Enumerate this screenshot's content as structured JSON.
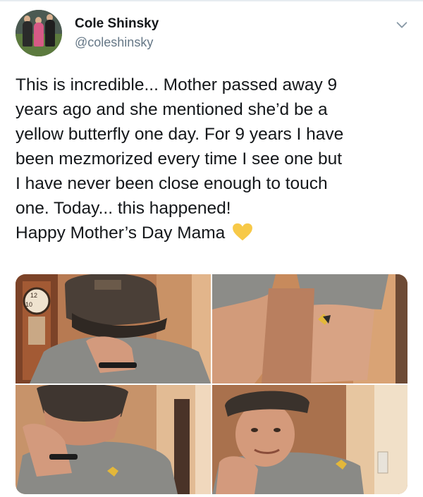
{
  "tweet": {
    "author_name": "Cole Shinsky",
    "author_handle": "@coleshinsky",
    "text_lines": [
      "This is incredible... Mother passed away 9",
      "years ago and she mentioned she’d be a",
      "yellow butterfly one day. For 9 years I have",
      "been mezmorized every time I see one but",
      "I have never been close enough to touch",
      "one. Today... this happened!",
      "Happy Mother’s Day Mama"
    ],
    "emoji_icon": "yellow-heart-icon"
  },
  "media": {
    "photos": [
      {
        "name": "photo-man-head-down-hat"
      },
      {
        "name": "photo-butterfly-on-arm"
      },
      {
        "name": "photo-man-hand-on-face"
      },
      {
        "name": "photo-man-smiling-butterfly-shirt"
      }
    ],
    "clock_numerals": [
      "12",
      "10"
    ]
  },
  "colors": {
    "text": "#14171a",
    "handle": "#657786",
    "heart": "#f7c948",
    "chevron": "#8899a6"
  }
}
